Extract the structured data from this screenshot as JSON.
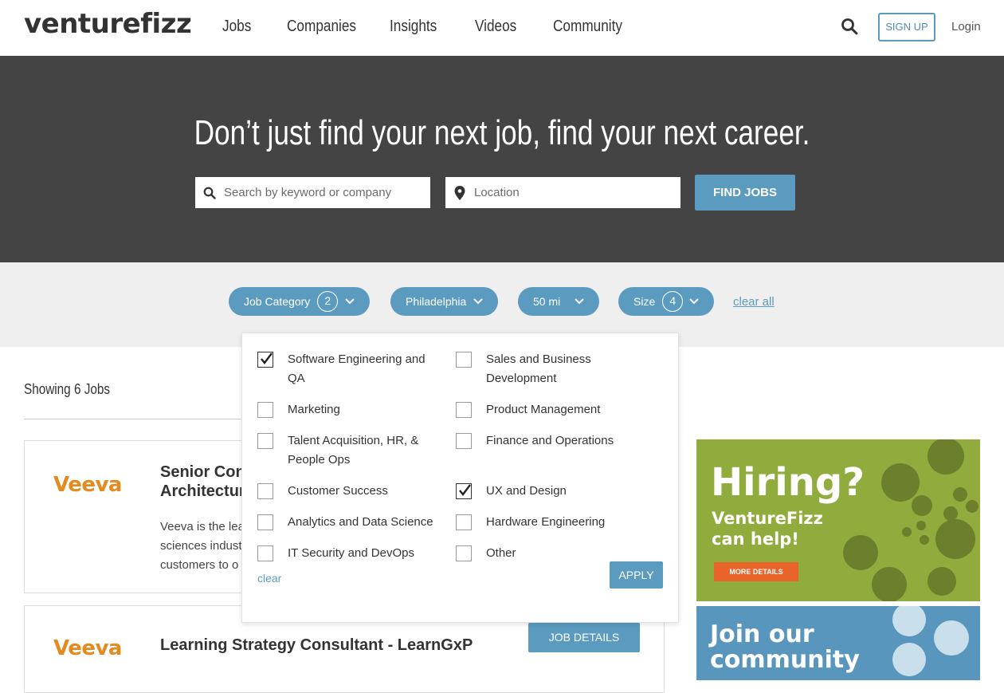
{
  "header": {
    "logo": "venturefizz",
    "nav": [
      "Jobs",
      "Companies",
      "Insights",
      "Videos",
      "Community"
    ],
    "signup": "SIGN UP",
    "login": "Login"
  },
  "hero": {
    "title": "Don’t just find your next job, find your next career.",
    "search_placeholder": "Search by keyword or company",
    "location_placeholder": "Location",
    "find_button": "FIND JOBS"
  },
  "filters": {
    "job_category": {
      "label": "Job Category",
      "count": "2"
    },
    "location": {
      "label": "Philadelphia"
    },
    "distance": {
      "label": "50 mi"
    },
    "size": {
      "label": "Size",
      "count": "4"
    },
    "clear_all": "clear all"
  },
  "dropdown": {
    "options": [
      {
        "label": "Software Engineering and QA",
        "checked": true
      },
      {
        "label": "Sales and Business Development",
        "checked": false
      },
      {
        "label": "Marketing",
        "checked": false
      },
      {
        "label": "Product Management",
        "checked": false
      },
      {
        "label": "Talent Acquisition, HR, & People Ops",
        "checked": false
      },
      {
        "label": "Finance and Operations",
        "checked": false
      },
      {
        "label": "Customer Success",
        "checked": false
      },
      {
        "label": "UX and Design",
        "checked": true
      },
      {
        "label": "Analytics and Data Science",
        "checked": false
      },
      {
        "label": "Hardware Engineering",
        "checked": false
      },
      {
        "label": "IT Security and DevOps",
        "checked": false
      },
      {
        "label": "Other",
        "checked": false
      }
    ],
    "clear": "clear",
    "apply": "APPLY"
  },
  "results": {
    "showing": "Showing 6 Jobs",
    "jobs": [
      {
        "company_logo": "Veeva",
        "title_line1": "Senior Cons",
        "title_line2": "Architectur",
        "desc_line1": "Veeva is the lea",
        "desc_line2": "sciences indust",
        "desc_line3": "customers to o"
      },
      {
        "company_logo": "Veeva",
        "title_line1": "Learning Strategy Consultant - LearnGxP",
        "button": "JOB DETAILS"
      }
    ]
  },
  "ads": {
    "hiring_title": "Hiring?",
    "hiring_sub1": "VentureFizz",
    "hiring_sub2": "can help!",
    "more_details": "MORE DETAILS",
    "join_line1": "Join our",
    "join_line2": "community"
  },
  "colors": {
    "accent": "#5b9bc0",
    "hero_bg": "#444444",
    "ad_green": "#8fac3c",
    "ad_blue": "#5896bd",
    "veeva_orange": "#e58a1f"
  }
}
